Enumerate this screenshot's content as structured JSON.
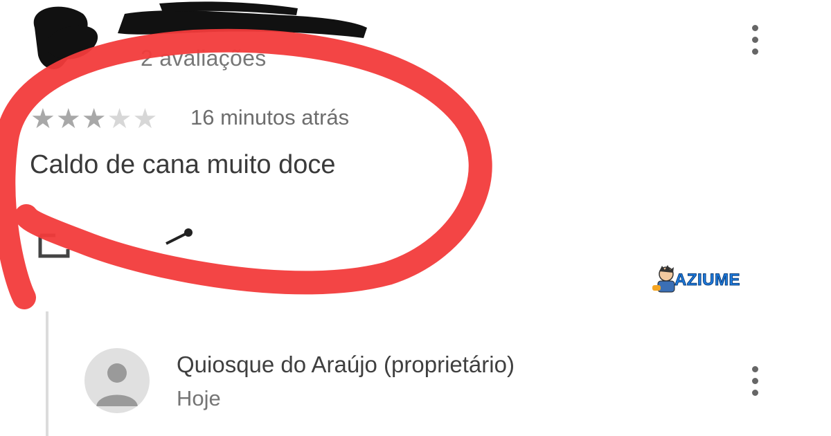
{
  "review": {
    "subtitle": "2 avaliações",
    "rating": 3,
    "max_rating": 5,
    "time_ago": "16 minutos atrás",
    "text": "Caldo de cana muito doce"
  },
  "reply": {
    "owner_name": "Quiosque do Araújo (proprietário)",
    "date": "Hoje"
  },
  "icons": {
    "review_menu": "more-vert-icon",
    "reply_menu": "more-vert-icon",
    "edit": "edit-icon",
    "share": "share-icon",
    "avatar": "person-icon"
  },
  "watermark": {
    "text": "AZIUME"
  },
  "colors": {
    "annotation_red": "#f23b3b",
    "watermark_blue": "#1f7de0"
  }
}
